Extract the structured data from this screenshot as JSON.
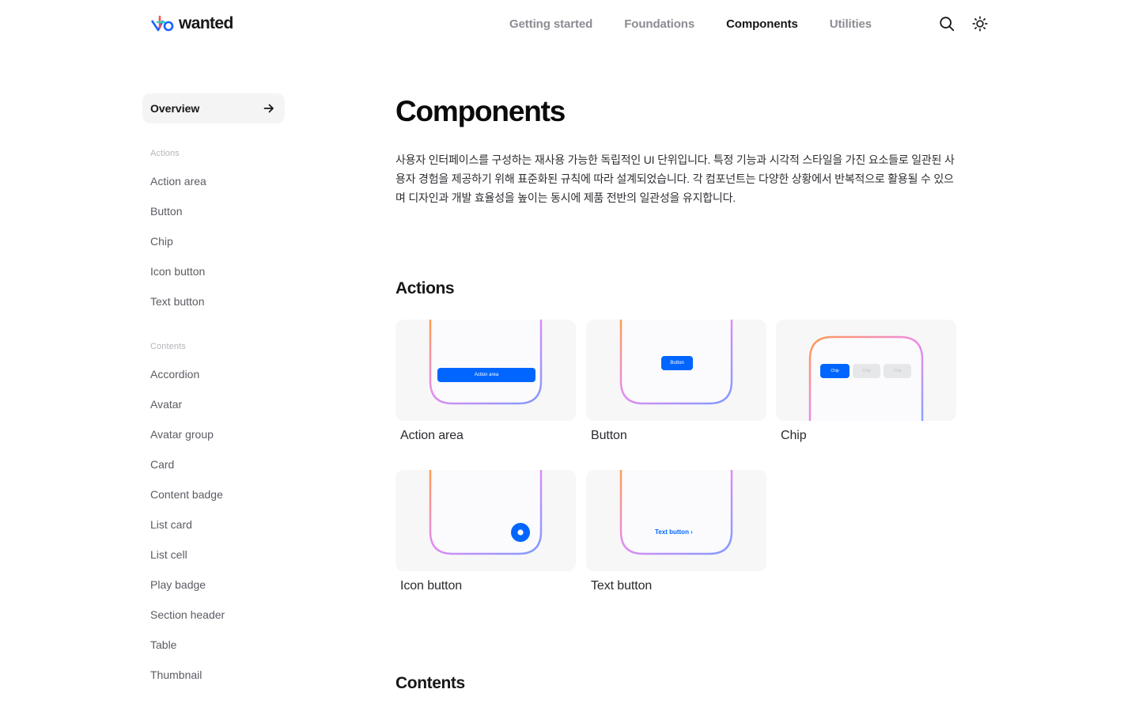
{
  "brand": {
    "name": "wanted"
  },
  "nav": {
    "items": [
      {
        "label": "Getting started",
        "active": false
      },
      {
        "label": "Foundations",
        "active": false
      },
      {
        "label": "Components",
        "active": true
      },
      {
        "label": "Utilities",
        "active": false
      }
    ]
  },
  "header_icons": [
    "search-icon",
    "sun-icon"
  ],
  "sidebar": {
    "overview_label": "Overview",
    "groups": [
      {
        "label": "Actions",
        "items": [
          "Action area",
          "Button",
          "Chip",
          "Icon button",
          "Text button"
        ]
      },
      {
        "label": "Contents",
        "items": [
          "Accordion",
          "Avatar",
          "Avatar group",
          "Card",
          "Content badge",
          "List card",
          "List cell",
          "Play badge",
          "Section header",
          "Table",
          "Thumbnail"
        ]
      }
    ]
  },
  "main": {
    "title": "Components",
    "description": "사용자 인터페이스를 구성하는 재사용 가능한 독립적인 UI 단위입니다. 특정 기능과 시각적 스타일을 가진 요소들로 일관된 사용자 경험을 제공하기 위해 표준화된 규칙에 따라 설계되었습니다. 각 컴포넌트는 다양한 상황에서 반복적으로 활용될 수 있으며 디자인과 개발 효율성을 높이는 동시에 제품 전반의 일관성을 유지합니다.",
    "sections": [
      {
        "title": "Actions",
        "cards": [
          {
            "name": "Action area",
            "preview_label": "Action area"
          },
          {
            "name": "Button",
            "preview_label": "Button"
          },
          {
            "name": "Chip",
            "preview_labels": [
              "Chip",
              "Chip",
              "Chip"
            ]
          },
          {
            "name": "Icon button"
          },
          {
            "name": "Text button",
            "preview_label": "Text button ›"
          }
        ]
      },
      {
        "title": "Contents"
      }
    ]
  },
  "colors": {
    "accent": "#0066ff",
    "text_primary": "#171719",
    "text_muted": "#8b8d92",
    "card_bg": "#f7f7f8"
  }
}
